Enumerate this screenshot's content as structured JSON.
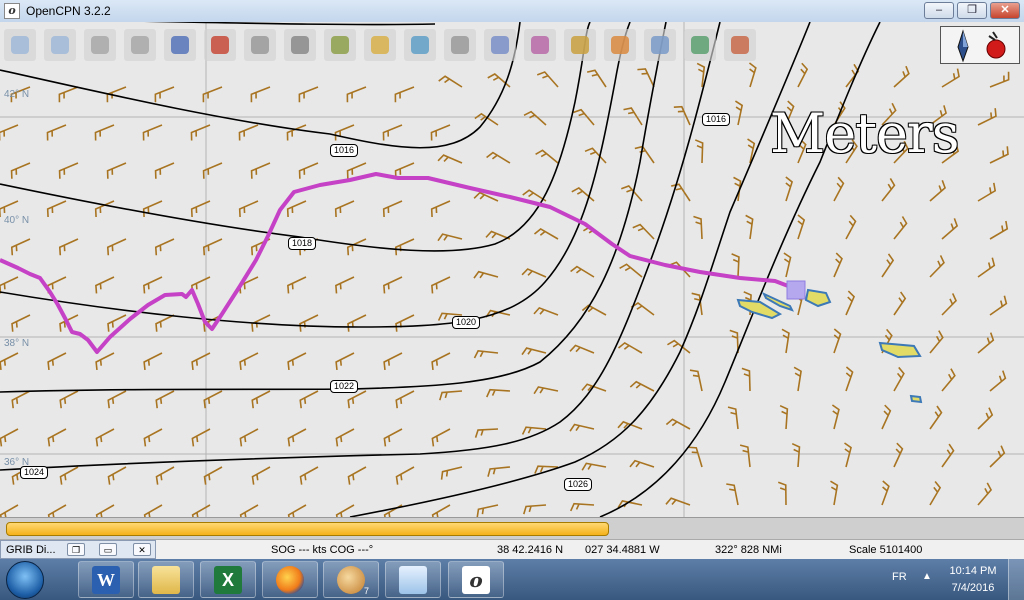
{
  "window": {
    "title": "OpenCPN 3.2.2",
    "app_icon": "opencpn-logo-icon",
    "minimize": "‒",
    "restore": "❐",
    "close": "✕"
  },
  "toolbar": {
    "tools": [
      "zoom-in-icon",
      "zoom-out-icon",
      "scale-in-icon",
      "scale-out-icon",
      "route-icon",
      "ship-icon",
      "settings-icon",
      "text-icon",
      "measure-icon",
      "chart-icon",
      "tide-icon",
      "print-icon",
      "route-manager-icon",
      "track-icon",
      "color-scheme-icon",
      "mob-icon",
      "help-icon",
      "grib-icon",
      "dashboard-icon"
    ]
  },
  "compass": {
    "north_icon": "compass-north-icon",
    "gps_icon": "gps-status-icon"
  },
  "chart": {
    "overlay_text": "Meters",
    "latitudes": [
      "42° N",
      "40° N",
      "38° N",
      "36° N"
    ],
    "isobars": [
      "1016",
      "1016",
      "1018",
      "1020",
      "1022",
      "1024",
      "1024",
      "1026"
    ]
  },
  "progress": {
    "value": 0.59
  },
  "statusbar": {
    "grib_tab": "GRIB Di...",
    "sog": "SOG --- kts  COG ---°",
    "lat": "38 42.2416 N",
    "lon": "027 34.4881 W",
    "brg": "322°  828 NMi",
    "scale": "Scale 5101400"
  },
  "taskbar": {
    "apps": [
      "start-orb-icon",
      "word-icon",
      "file-explorer-icon",
      "excel-icon",
      "firefox-icon",
      "paint-icon",
      "notepad-icon",
      "opencpn-icon"
    ],
    "paint_badge": "7",
    "language": "FR",
    "time": "10:14 PM",
    "date": "7/4/2016"
  },
  "colors": {
    "route": "#c541c6",
    "wind_barb": "#a87421",
    "isobar": "#000000",
    "island_fill": "#e2dc66",
    "island_edge": "#3c79b6"
  }
}
